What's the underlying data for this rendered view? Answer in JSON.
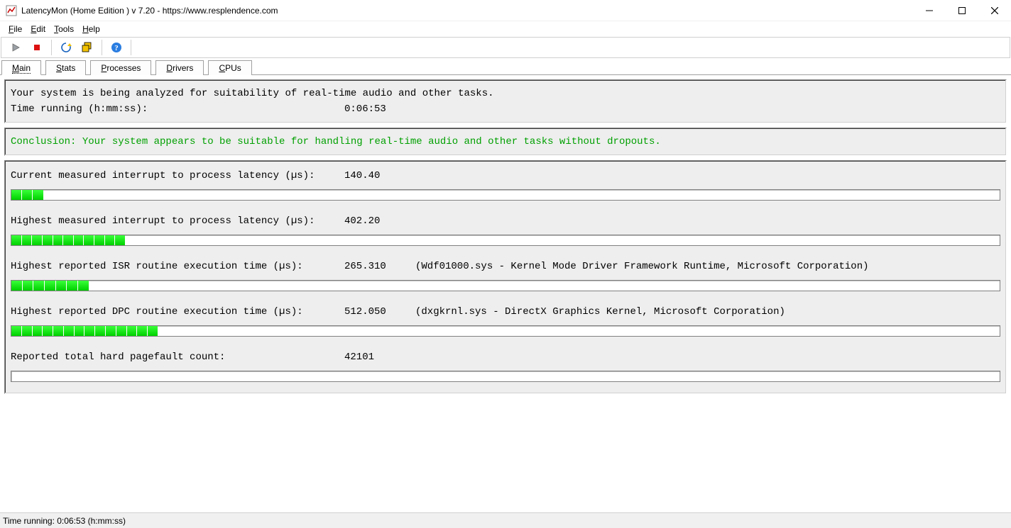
{
  "window": {
    "title": "LatencyMon  (Home Edition )  v 7.20 - https://www.resplendence.com"
  },
  "menu": {
    "file": "File",
    "edit": "Edit",
    "tools": "Tools",
    "help": "Help"
  },
  "tabs": {
    "main": "Main",
    "stats": "Stats",
    "processes": "Processes",
    "drivers": "Drivers",
    "cpus": "CPUs"
  },
  "header": {
    "line1": "Your system is being analyzed for suitability of real-time audio and other tasks.",
    "timeLabel": "Time running (h:mm:ss):",
    "timeValue": "0:06:53"
  },
  "conclusion": "Conclusion: Your system appears to be suitable for handling real-time audio and other tasks without dropouts.",
  "metrics": {
    "current": {
      "label": "Current measured interrupt to process latency (µs):",
      "value": "140.40",
      "extra": "",
      "segs": 3,
      "pct": 3.2
    },
    "highest": {
      "label": "Highest measured interrupt to process latency (µs):",
      "value": "402.20",
      "extra": "",
      "segs": 11,
      "pct": 11.5
    },
    "isr": {
      "label": "Highest reported ISR routine execution time (µs):",
      "value": "265.310",
      "extra": "(Wdf01000.sys - Kernel Mode Driver Framework Runtime, Microsoft Corporation)",
      "segs": 7,
      "pct": 7.8
    },
    "dpc": {
      "label": "Highest reported DPC routine execution time (µs):",
      "value": "512.050",
      "extra": "(dxgkrnl.sys - DirectX Graphics Kernel, Microsoft Corporation)",
      "segs": 14,
      "pct": 14.8
    },
    "pagefault": {
      "label": "Reported total hard pagefault count:",
      "value": "42101",
      "extra": "",
      "segs": 0,
      "pct": 0
    }
  },
  "status": {
    "text": "Time running: 0:06:53  (h:mm:ss)"
  }
}
